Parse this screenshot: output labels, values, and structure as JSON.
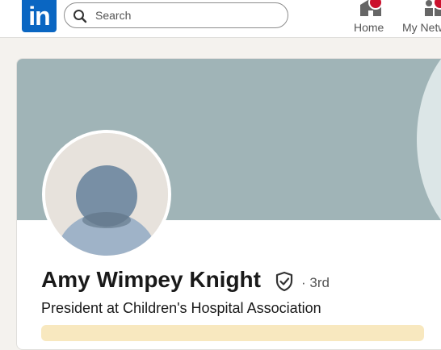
{
  "header": {
    "logo_text": "in",
    "search": {
      "placeholder": "Search",
      "value": ""
    },
    "nav": [
      {
        "label": "Home",
        "icon": "home-icon"
      },
      {
        "label": "My Network",
        "icon": "people-icon"
      }
    ]
  },
  "profile": {
    "name": "Amy Wimpey Knight",
    "degree": "· 3rd",
    "headline": "President at Children's Hospital Association",
    "verified_icon": "verified-shield-icon"
  },
  "colors": {
    "brand": "#0a66c2",
    "notification": "#cb112d",
    "banner": "#a0b4b7",
    "promo": "#f8e8bf"
  }
}
